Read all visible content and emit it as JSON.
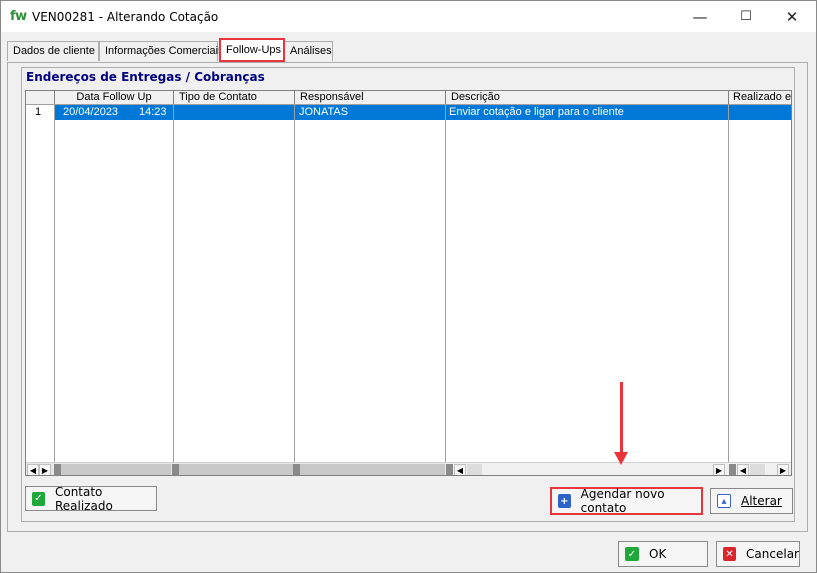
{
  "window": {
    "logo": "fw",
    "title": "VEN00281  -  Alterando Cotação",
    "minimize": "—",
    "maximize": "☐",
    "close": "✕"
  },
  "tabs": [
    {
      "label": "Dados de cliente"
    },
    {
      "label": "Informações Comerciais"
    },
    {
      "label": "Follow-Ups",
      "active": true
    },
    {
      "label": "Análises"
    }
  ],
  "group": {
    "title": "Endereços de Entregas / Cobranças"
  },
  "grid": {
    "columns": [
      "",
      "Data Follow Up",
      "Tipo de Contato",
      "Responsável",
      "Descrição",
      "Realizado e"
    ],
    "rows": [
      {
        "index": "1",
        "date": "20/04/2023",
        "time": "14:23",
        "tipo": "",
        "responsavel": "JONATAS",
        "descricao": "Enviar cotação e ligar para o cliente",
        "realizado": ""
      }
    ]
  },
  "buttons": {
    "contato_realizado": "Contato Realizado",
    "agendar": "Agendar novo contato",
    "alterar": "Alterar",
    "ok": "OK",
    "cancelar": "Cancelar"
  },
  "colors": {
    "accent_highlight": "#e8343c",
    "selection": "#0078d7",
    "group_title": "#000080",
    "logo": "#2f8f3a"
  }
}
